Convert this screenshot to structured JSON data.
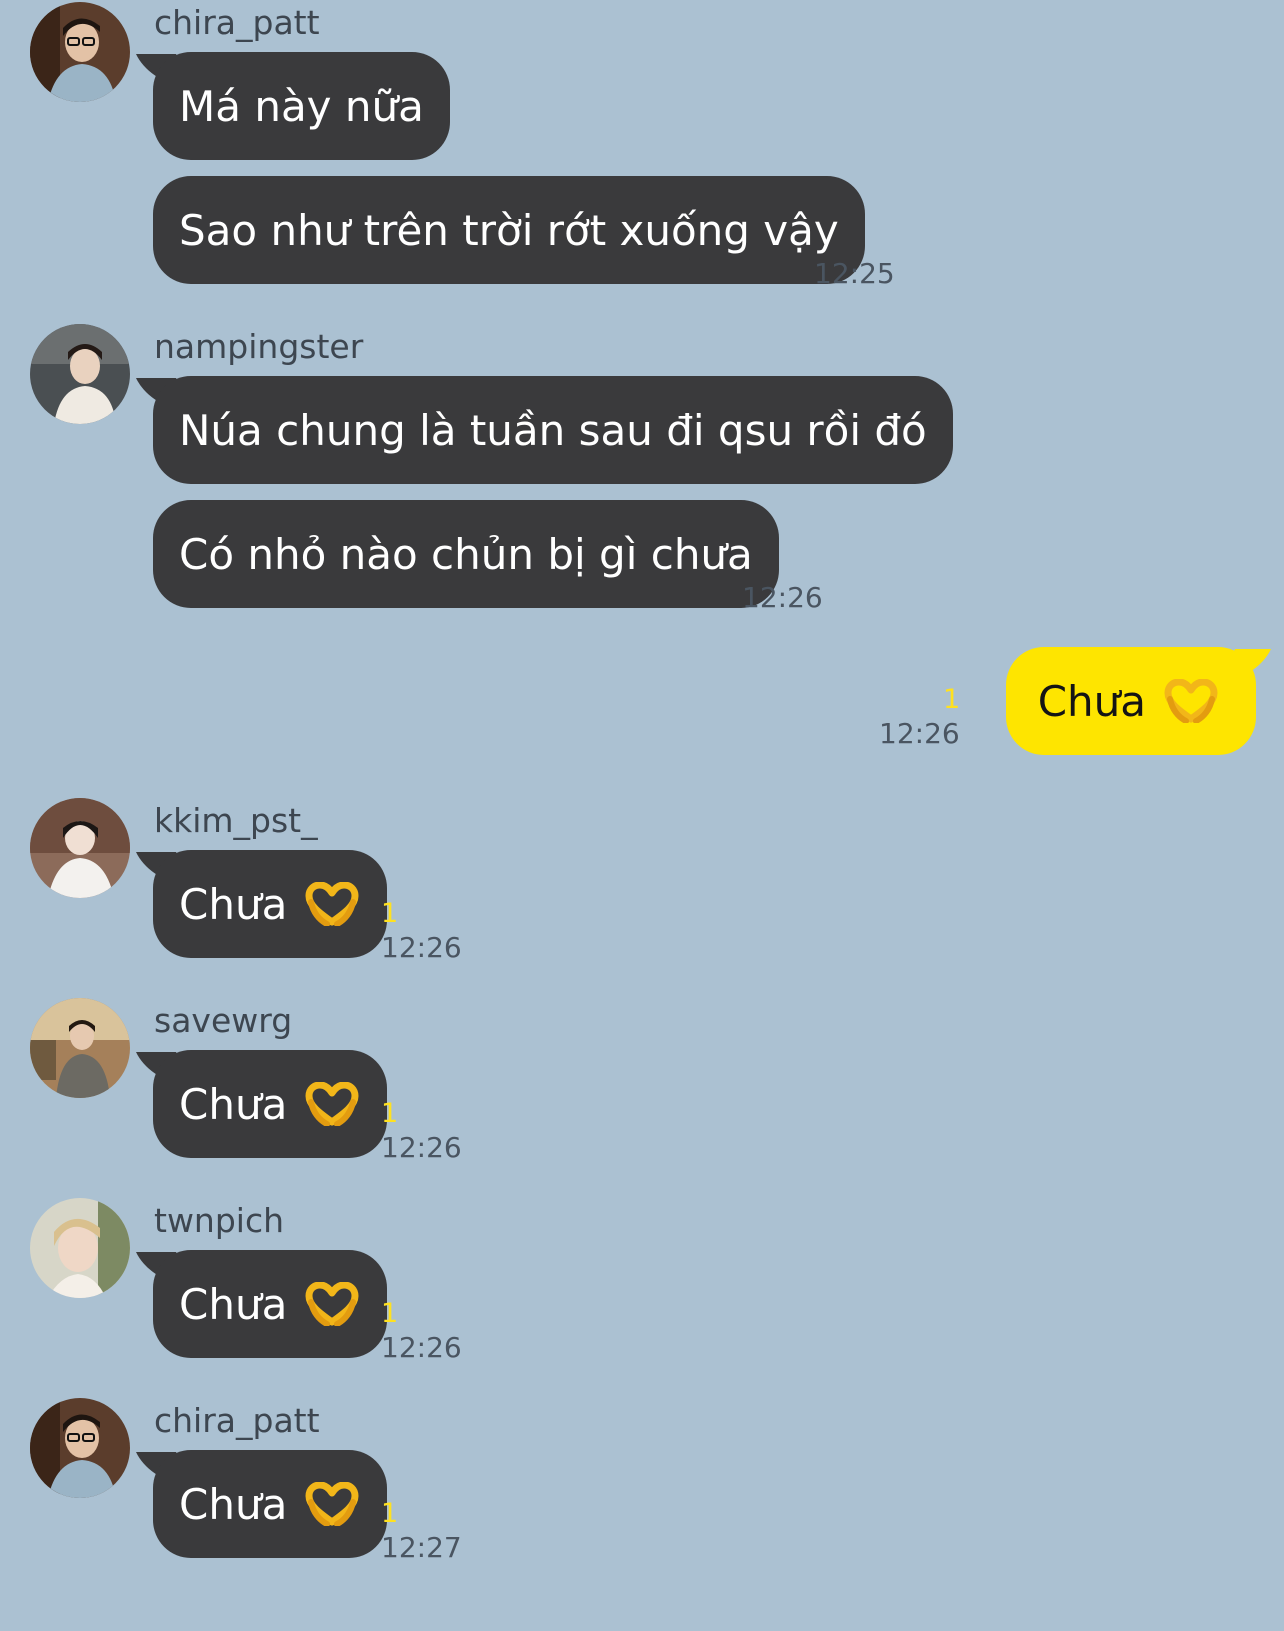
{
  "colors": {
    "background": "#abc1d2",
    "other_bubble": "#3a3a3c",
    "my_bubble": "#fee500",
    "unread": "#ffe11f"
  },
  "messages": [
    {
      "sender": "chira_patt",
      "bubbles": [
        "Má này nữa",
        "Sao như trên trời rớt xuống vậy"
      ],
      "time": "12:25"
    },
    {
      "sender": "nampingster",
      "bubbles": [
        "Núa chung là tuần sau đi qsu rồi đó",
        "Có nhỏ nào chủn bị gì chưa"
      ],
      "time": "12:26"
    },
    {
      "sender": "me",
      "text": "Chưa",
      "emoji": "heart-hands-icon",
      "time": "12:26",
      "unread": "1"
    },
    {
      "sender": "kkim_pst_",
      "text": "Chưa",
      "emoji": "heart-hands-icon",
      "time": "12:26",
      "unread": "1"
    },
    {
      "sender": "savewrg",
      "text": "Chưa",
      "emoji": "heart-hands-icon",
      "time": "12:26",
      "unread": "1"
    },
    {
      "sender": "twnpich",
      "text": "Chưa",
      "emoji": "heart-hands-icon",
      "time": "12:26",
      "unread": "1"
    },
    {
      "sender": "chira_patt",
      "text": "Chưa",
      "emoji": "heart-hands-icon",
      "time": "12:27",
      "unread": "1"
    }
  ]
}
